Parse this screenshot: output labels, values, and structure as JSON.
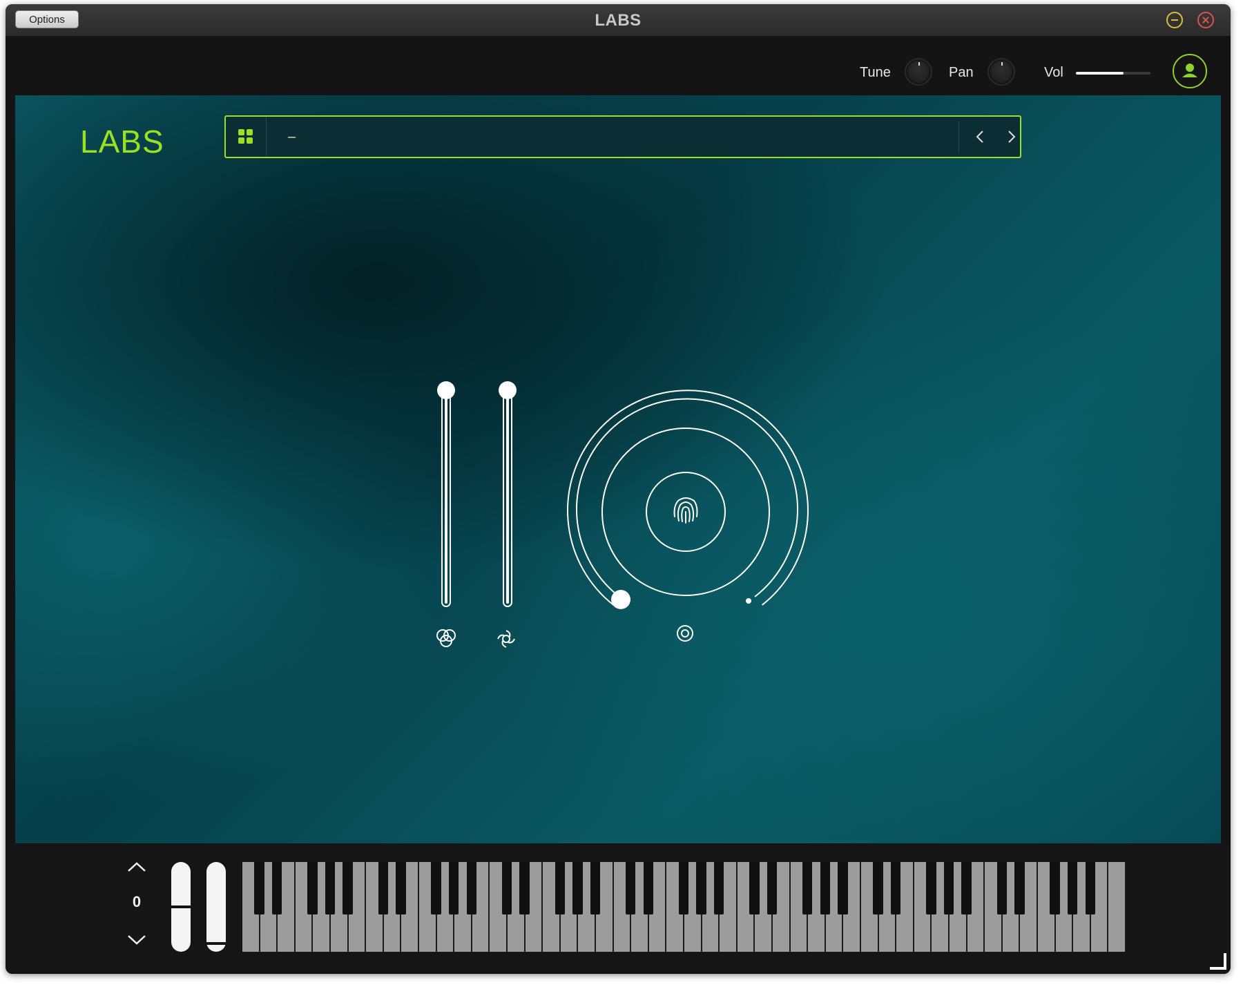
{
  "window": {
    "title": "LABS",
    "options_label": "Options"
  },
  "header": {
    "tune_label": "Tune",
    "pan_label": "Pan",
    "vol_label": "Vol",
    "vol_level": 0.64
  },
  "main": {
    "logo": "LABS",
    "preset_name": "–",
    "icons": {
      "grid": "grid-icon",
      "prev": "chevron-left-icon",
      "next": "chevron-right-icon",
      "slider1": "trefoil-icon",
      "slider2": "swirl-icon",
      "dial_center": "fingerprint-icon",
      "dial_bottom": "target-icon"
    },
    "slider1_level": 1.0,
    "slider2_level": 1.0,
    "dial_level": 0.0
  },
  "keyboard": {
    "octave": "0",
    "colors": {
      "accent": "#9be023",
      "white_key": "#9c9c9c",
      "black_key": "#101010"
    }
  }
}
